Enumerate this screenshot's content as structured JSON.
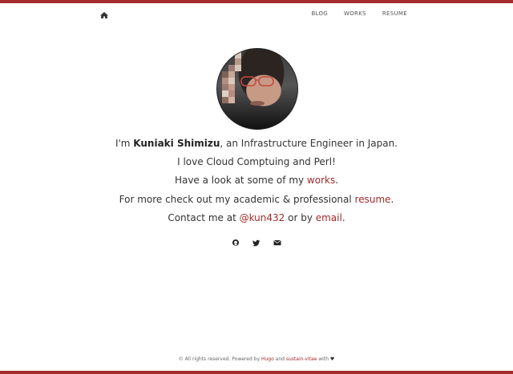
{
  "header": {
    "home_icon": "home-icon",
    "links": [
      "BLOG",
      "WORKS",
      "RESUME"
    ]
  },
  "profile": {
    "avatar_alt": "Kuniaki Shimizu",
    "intro_prefix": "I'm ",
    "name": "Kuniaki Shimizu",
    "intro_suffix": ", an Infrastructure Engineer in Japan.",
    "line_love": "I love Cloud Comptuing and Perl!",
    "works_prefix": "Have a look at some of my ",
    "works_link": "works",
    "works_suffix": ".",
    "resume_prefix": "For more check out my academic & professional ",
    "resume_link": "resume",
    "resume_suffix": ".",
    "contact_prefix": "Contact me at ",
    "twitter_handle": "@kun432",
    "contact_mid": " or by ",
    "email_link": "email",
    "contact_suffix": "."
  },
  "social": [
    "github-icon",
    "twitter-icon",
    "envelope-icon"
  ],
  "footer": {
    "prefix": "© All rights reserved. Powered by ",
    "hugo": "Hugo",
    "and": " and ",
    "theme": "sustain-vitae",
    "with": " with ",
    "heart": "♥"
  },
  "colors": {
    "accent": "#a52a2a",
    "text": "#333333",
    "border": "#a52a2a"
  }
}
